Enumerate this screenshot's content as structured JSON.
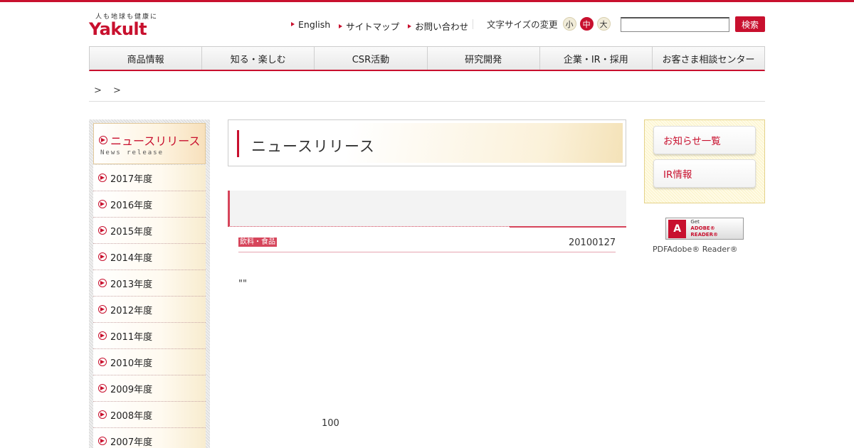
{
  "header": {
    "tagline": "人も地球も健康に",
    "logo": "Yakult",
    "links": [
      "English",
      "サイトマップ",
      "お問い合わせ"
    ],
    "fontsize_label": "文字サイズの変更",
    "fontsize_options": [
      "小",
      "中",
      "大"
    ],
    "search_placeholder": "",
    "search_button": "検索"
  },
  "nav": [
    "商品情報",
    "知る・楽しむ",
    "CSR活動",
    "研究開発",
    "企業・IR・採用",
    "お客さま相談センター"
  ],
  "breadcrumb": "> >",
  "sidebar": {
    "title": "ニュースリリース",
    "subtitle": "News release",
    "items": [
      "2017年度",
      "2016年度",
      "2015年度",
      "2014年度",
      "2013年度",
      "2012年度",
      "2011年度",
      "2010年度",
      "2009年度",
      "2008年度",
      "2007年度"
    ]
  },
  "main": {
    "page_title": "ニュースリリース",
    "category": "飲料・食品",
    "date": "20100127",
    "body_text": "\"\"",
    "count": "100"
  },
  "right": {
    "buttons": [
      "お知らせ一覧",
      "IR情報"
    ],
    "adobe_get": "Get",
    "adobe_name": "ADOBE® READER®",
    "pdf_note": "PDFAdobe® Reader®"
  }
}
